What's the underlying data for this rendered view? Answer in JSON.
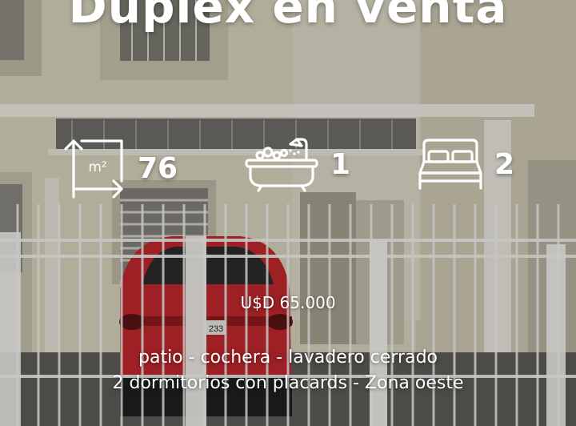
{
  "title": "Duplex en venta",
  "features": {
    "area": {
      "icon": "area-m2-icon",
      "badge": "m²",
      "value": "76"
    },
    "bathrooms": {
      "icon": "bathtub-icon",
      "value": "1"
    },
    "bedrooms": {
      "icon": "bed-icon",
      "value": "2"
    }
  },
  "plate_text": "233",
  "price": "U$D 65.000",
  "description": {
    "line1": "patio - cochera - lavadero cerrado",
    "line2": "2 dormitorios con placards - Zona oeste"
  },
  "colors": {
    "text": "#ffffff",
    "car": "#c0282c",
    "facade": "#d8d3bd"
  }
}
